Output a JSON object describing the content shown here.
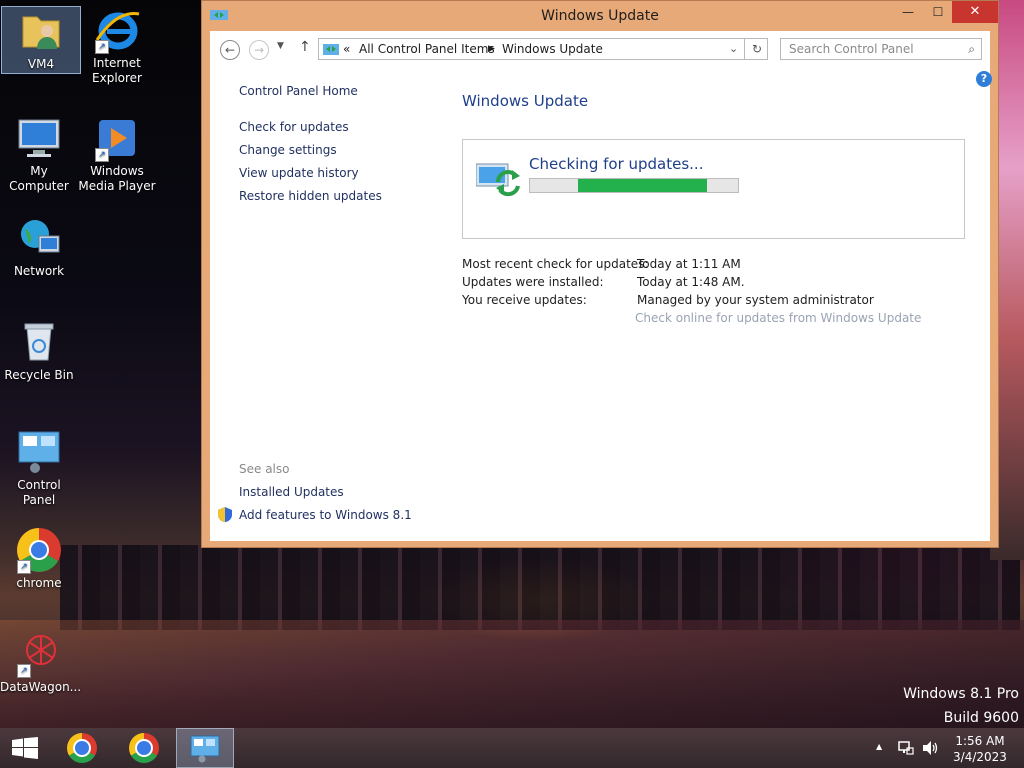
{
  "desktop": {
    "icons": [
      {
        "label": "VM4",
        "icon": "user-folder-icon"
      },
      {
        "label": "Internet Explorer",
        "icon": "internet-explorer-icon"
      },
      {
        "label": "My Computer",
        "icon": "computer-icon"
      },
      {
        "label": "Windows Media Player",
        "icon": "media-player-icon"
      },
      {
        "label": "Network",
        "icon": "network-globe-icon"
      },
      {
        "label": "Recycle Bin",
        "icon": "recycle-bin-icon"
      },
      {
        "label": "Control Panel",
        "icon": "control-panel-icon"
      },
      {
        "label": "chrome",
        "icon": "chrome-icon"
      },
      {
        "label": "DataWagon...",
        "icon": "datawagon-icon"
      }
    ],
    "os_edition": "Windows 8.1 Pro",
    "os_build": "Build 9600"
  },
  "window": {
    "title": "Windows Update",
    "controls": {
      "minimize": "—",
      "maximize": "☐",
      "close": "✕"
    },
    "breadcrumb": {
      "overflow": "«",
      "items": [
        "All Control Panel Items",
        "Windows Update"
      ]
    },
    "search_placeholder": "Search Control Panel",
    "help_symbol": "?",
    "left_pane": {
      "home": "Control Panel Home",
      "links": [
        "Check for updates",
        "Change settings",
        "View update history",
        "Restore hidden updates"
      ],
      "see_also_heading": "See also",
      "see_also": [
        "Installed Updates",
        "Add features to Windows 8.1"
      ]
    },
    "main": {
      "heading": "Windows Update",
      "status": "Checking for updates...",
      "progress": {
        "start": 0.23,
        "end": 0.85
      },
      "info": [
        {
          "label": "Most recent check for updates:",
          "value": "Today at 1:11 AM"
        },
        {
          "label": "Updates were installed:",
          "value": "Today at 1:48 AM."
        },
        {
          "label": "You receive updates:",
          "value": "Managed by your system administrator"
        }
      ],
      "online_link": "Check online for updates from Windows Update"
    }
  },
  "taskbar": {
    "start_icon": "windows-start-icon",
    "pinned": [
      "chrome-icon",
      "chrome-icon",
      "control-panel-icon"
    ],
    "tray": {
      "chevron": "▲",
      "network_icon": "network-tray-icon",
      "volume_icon": "volume-icon"
    },
    "clock_time": "1:56 AM",
    "clock_date": "3/4/2023"
  },
  "colors": {
    "accent_link": "#1f3f8a",
    "progress": "#22b14c",
    "close": "#c7352e",
    "frame": "#e8a978"
  }
}
